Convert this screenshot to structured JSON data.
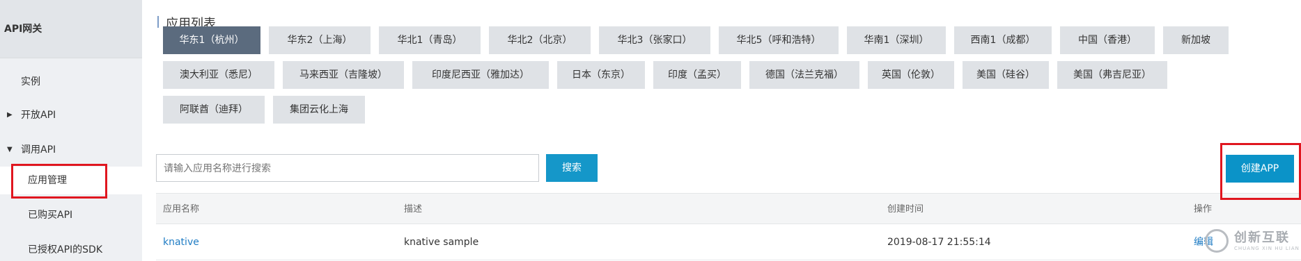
{
  "sidebar": {
    "title": "API网关",
    "items": [
      {
        "label": "实例"
      },
      {
        "label": "开放API",
        "caret": "▶"
      },
      {
        "label": "调用API",
        "caret": "▼"
      },
      {
        "label": "应用管理"
      },
      {
        "label": "已购买API"
      },
      {
        "label": "已授权API的SDK"
      }
    ]
  },
  "main": {
    "title": "应用列表",
    "regions_row1": [
      "华东1（杭州）",
      "华东2（上海）",
      "华北1（青岛）",
      "华北2（北京）",
      "华北3（张家口）",
      "华北5（呼和浩特）",
      "华南1（深圳）",
      "西南1（成都）",
      "中国（香港）",
      "新加坡"
    ],
    "regions_row2": [
      "澳大利亚（悉尼）",
      "马来西亚（吉隆坡）",
      "印度尼西亚（雅加达）",
      "日本（东京）",
      "印度（孟买）",
      "德国（法兰克福）",
      "英国（伦敦）",
      "美国（硅谷）",
      "美国（弗吉尼亚）"
    ],
    "regions_row3": [
      "阿联酋（迪拜）",
      "集团云化上海"
    ],
    "selected_region": "华东1（杭州）",
    "search": {
      "placeholder": "请输入应用名称进行搜索",
      "button": "搜索"
    },
    "create_button": "创建APP",
    "table": {
      "headers": {
        "name": "应用名称",
        "desc": "描述",
        "created": "创建时间",
        "ops": "操作"
      },
      "rows": [
        {
          "name": "knative",
          "desc": "knative sample",
          "created": "2019-08-17 21:55:14",
          "op": "编辑"
        }
      ]
    }
  },
  "watermark": {
    "text": "创新互联",
    "sub": "CHUANG XIN HU LIAN"
  },
  "colors": {
    "accent": "#1597c9",
    "active_region": "#5b6b7e",
    "highlight": "#e0161f",
    "link": "#1f7cc4"
  }
}
